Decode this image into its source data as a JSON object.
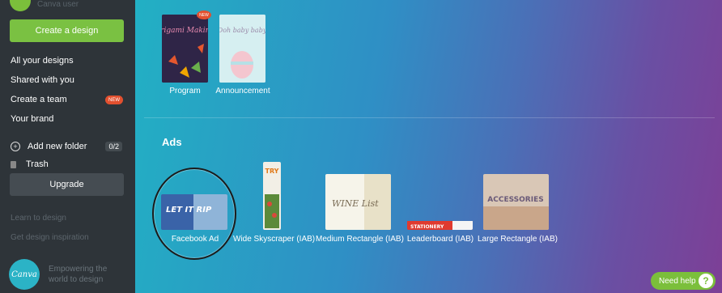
{
  "sidebar": {
    "account_name": "Canva user",
    "create_button": "Create a design",
    "nav": {
      "all_designs": "All your designs",
      "shared": "Shared with you",
      "create_team": "Create a team",
      "team_badge": "NEW",
      "brand": "Your brand"
    },
    "folder": {
      "label": "Add new folder",
      "count": "0/2"
    },
    "trash": "Trash",
    "upgrade_button": "Upgrade",
    "links": {
      "learn": "Learn to design",
      "inspiration": "Get design inspiration"
    },
    "logo_text": "Canva",
    "tagline": "Empowering the world to design"
  },
  "main": {
    "top_templates": [
      {
        "caption": "Program",
        "badge": "NEW",
        "art_title": "Origami Making"
      },
      {
        "caption": "Announcement",
        "art_title": "Ooh baby baby"
      }
    ],
    "ads_section_title": "Ads",
    "ads": [
      {
        "caption": "Facebook Ad",
        "art_text": "LET IT RIP"
      },
      {
        "caption": "Wide Skyscraper (IAB)",
        "art_text": "TRY"
      },
      {
        "caption": "Medium Rectangle (IAB)",
        "art_text": "WINE List"
      },
      {
        "caption": "Leaderboard (IAB)",
        "art_text": "STATIONERY"
      },
      {
        "caption": "Large Rectangle (IAB)",
        "art_text": "ACCESSORIES"
      }
    ],
    "help_button": "Need help",
    "help_icon": "?"
  },
  "colors": {
    "sidebar": "#2e3439",
    "accent_green": "#7ac142",
    "badge_red": "#e2502f"
  }
}
